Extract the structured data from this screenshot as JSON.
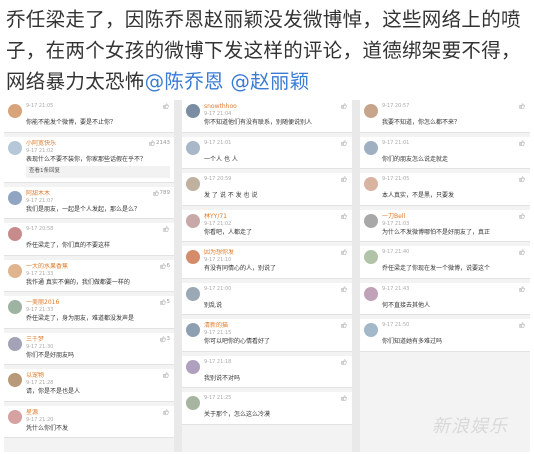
{
  "headline": {
    "text": "乔任梁走了，因陈乔恩赵丽颖没发微博悼，这些网络上的喷子，在两个女孩的微博下发这样的评论，道德绑架要不得，网络暴力太恐怖",
    "mention1": "@陈乔恩",
    "mention2": "@赵丽颖"
  },
  "watermark": "新浪娱乐",
  "columns": [
    {
      "cards": [
        {
          "avatar_color": "#d9a37a",
          "name": "",
          "time": "9-17 21:05",
          "likes": "",
          "text": "你能不能发个微博，要是不止你？"
        },
        {
          "avatar_color": "#b5c7d9",
          "name": "小阿宽快乐",
          "time": "9-17 21:02",
          "likes": "2143",
          "text": "表现什么不要不装你，你家那些话假在乎不？",
          "reply": {
            "name": "",
            "text": "查看1条回复"
          }
        },
        {
          "avatar_color": "#8fa5c2",
          "name": "阿甜木木",
          "time": "9-17 21:07",
          "likes": "789",
          "text": "我们是朋友，一起是个人发起，那么是么？"
        },
        {
          "avatar_color": "#c88b8b",
          "name": "",
          "time": "9-17 20:58",
          "likes": "",
          "text": "乔任梁走了，你们真的不要这样"
        },
        {
          "avatar_color": "#e0b48f",
          "name": "一大的水果香蕉",
          "time": "9-17 21:33",
          "likes": "6",
          "text": "我作通 真实不偏的，我们做都要一样的"
        },
        {
          "avatar_color": "#9fb3a3",
          "name": "一美丽2016",
          "time": "9-17 21:33",
          "likes": "5",
          "text": "乔任梁走了，身为朋友，难道都没发声是"
        },
        {
          "avatar_color": "#a3a3b8",
          "name": "三千梦",
          "time": "9-17 21:30",
          "likes": "3",
          "text": "你们不是好朋友吗"
        },
        {
          "avatar_color": "#b89a7a",
          "name": "以宠物",
          "time": "9-17 21:28",
          "likes": "",
          "text": "请，你是不是也是人"
        },
        {
          "avatar_color": "#d6a1a1",
          "name": "星源",
          "time": "9-17 21:20",
          "likes": "",
          "text": "凭什么你们不发"
        }
      ]
    },
    {
      "cards": [
        {
          "avatar_color": "#7a8da3",
          "name": "snowthhoo",
          "time": "9-17 21:04",
          "likes": "",
          "text": "你不知道他们有没有联系，别随便说别人"
        },
        {
          "avatar_color": "#a8b8c8",
          "name": "",
          "time": "9-17 21:01",
          "likes": "",
          "text": "一个人 也 人"
        },
        {
          "avatar_color": "#bfb0a0",
          "name": "",
          "time": "9-17 20:59",
          "likes": "",
          "text": "发 了 说 不 发 也 说"
        },
        {
          "avatar_color": "#c9a8a8",
          "name": "林YY/71",
          "time": "9-17 21:02",
          "likes": "",
          "text": "你看吧，人都走了"
        },
        {
          "avatar_color": "#d48c6b",
          "name": "因为想你发",
          "time": "9-17 21:10",
          "likes": "",
          "text": "有没有同情心的人，别说了"
        },
        {
          "avatar_color": "#9aa9b5",
          "name": "",
          "time": "9-17 21:00",
          "likes": "",
          "text": "别乱说"
        },
        {
          "avatar_color": "#8da0b2",
          "name": "清新的猫",
          "time": "9-17 21:15",
          "likes": "",
          "text": "你可以吧你的心情看好了"
        },
        {
          "avatar_color": "#b0a0c0",
          "name": "",
          "time": "9-17 21:18",
          "likes": "",
          "text": "我别说不对吗"
        },
        {
          "avatar_color": "#a6b5a0",
          "name": "",
          "time": "9-17 21:25",
          "likes": "",
          "text": "关于那个，怎么这么冷漠"
        }
      ]
    },
    {
      "cards": [
        {
          "avatar_color": "#c7a58a",
          "name": "",
          "time": "9-17 20:57",
          "likes": "",
          "text": "我要不知道，你怎么都不来？"
        },
        {
          "avatar_color": "#9fb0c2",
          "name": "",
          "time": "9-17 21:01",
          "likes": "",
          "text": "你们的朋友怎么说走就走"
        },
        {
          "avatar_color": "#d8b4a0",
          "name": "",
          "time": "9-17 21:05",
          "likes": "",
          "text": "本人真实，不是黑，只要发"
        },
        {
          "avatar_color": "#a8a8a8",
          "name": "一刀Bell",
          "time": "9-17 21:03",
          "likes": "",
          "text": "为什么不发微博哪怕不是好朋友了，真正"
        },
        {
          "avatar_color": "#b2c4a8",
          "name": "",
          "time": "9-17 21:40",
          "likes": "",
          "text": "乔任梁走了你现在发一个微博，说要这个"
        },
        {
          "avatar_color": "#c0a2b8",
          "name": "",
          "time": "9-17 21:43",
          "likes": "",
          "text": "何不直接去其他人"
        },
        {
          "avatar_color": "#a3b8c9",
          "name": "",
          "time": "9-17 21:50",
          "likes": "",
          "text": "你们知道她有多难过吗"
        }
      ]
    }
  ]
}
